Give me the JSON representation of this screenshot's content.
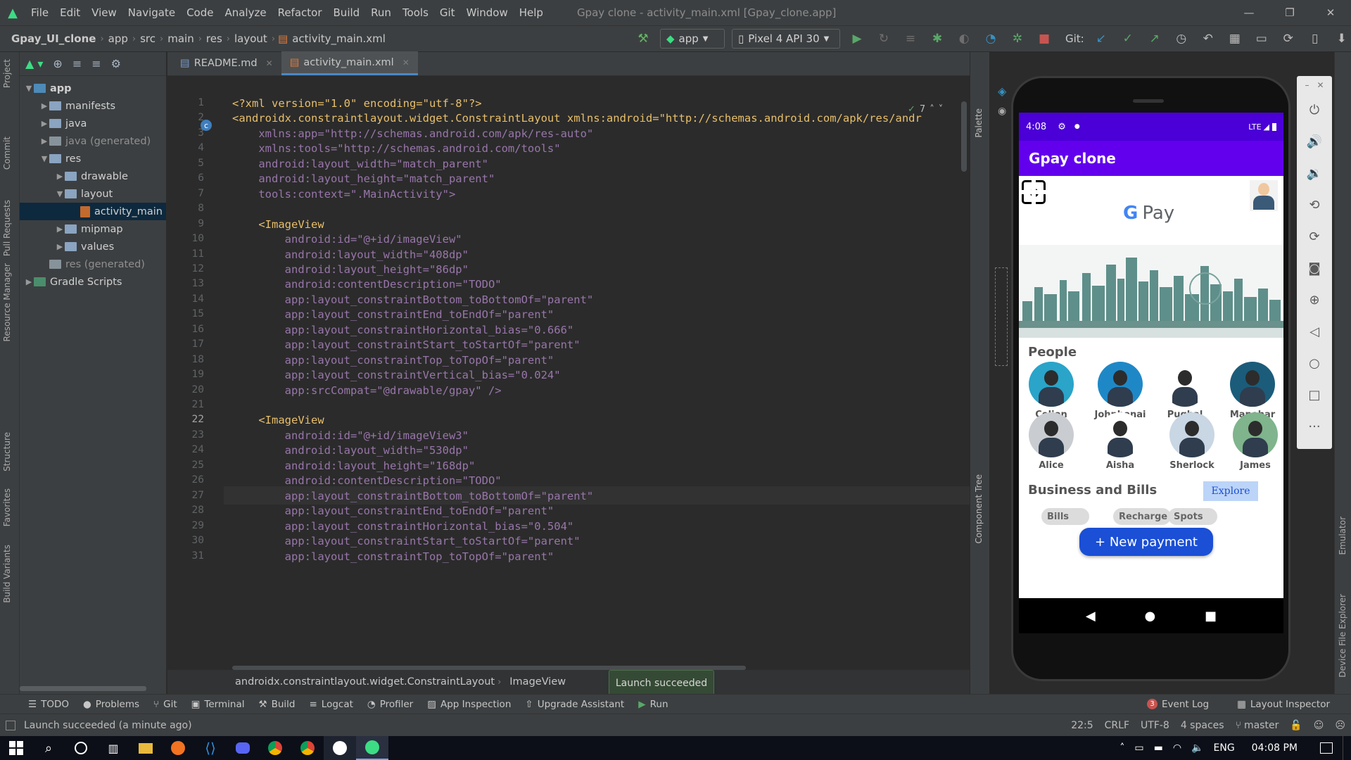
{
  "menu": {
    "items": [
      "File",
      "Edit",
      "View",
      "Navigate",
      "Code",
      "Analyze",
      "Refactor",
      "Build",
      "Run",
      "Tools",
      "Git",
      "Window",
      "Help"
    ],
    "title": "Gpay clone - activity_main.xml [Gpay_clone.app]"
  },
  "nav": {
    "crumbs": [
      "Gpay_UI_clone",
      "app",
      "src",
      "main",
      "res",
      "layout",
      "activity_main.xml"
    ],
    "run_config": "app",
    "device": "Pixel 4 API 30",
    "git_label": "Git:"
  },
  "project": {
    "items": [
      {
        "label": "app",
        "depth": 0,
        "open": true,
        "kind": "mod"
      },
      {
        "label": "manifests",
        "depth": 1,
        "open": false,
        "kind": "folder"
      },
      {
        "label": "java",
        "depth": 1,
        "open": false,
        "kind": "folder"
      },
      {
        "label": "java (generated)",
        "depth": 1,
        "open": false,
        "kind": "gray"
      },
      {
        "label": "res",
        "depth": 1,
        "open": true,
        "kind": "folder"
      },
      {
        "label": "drawable",
        "depth": 2,
        "open": false,
        "kind": "folder"
      },
      {
        "label": "layout",
        "depth": 2,
        "open": true,
        "kind": "folder"
      },
      {
        "label": "activity_main",
        "depth": 3,
        "open": null,
        "kind": "xml",
        "selected": true
      },
      {
        "label": "mipmap",
        "depth": 2,
        "open": false,
        "kind": "folder"
      },
      {
        "label": "values",
        "depth": 2,
        "open": false,
        "kind": "folder"
      },
      {
        "label": "res (generated)",
        "depth": 1,
        "open": null,
        "kind": "gray"
      },
      {
        "label": "Gradle Scripts",
        "depth": 0,
        "open": false,
        "kind": "gradle"
      }
    ]
  },
  "left_stripe": [
    "Project",
    "Commit",
    "Pull Requests",
    "Resource Manager",
    "Structure",
    "Favorites",
    "Build Variants"
  ],
  "editor": {
    "tabs": [
      {
        "label": "README.md",
        "active": false
      },
      {
        "label": "activity_main.xml",
        "active": true
      }
    ],
    "inspections": "7",
    "line_numbers": [
      "1",
      "2",
      "3",
      "4",
      "5",
      "6",
      "7",
      "8",
      "9",
      "10",
      "11",
      "12",
      "13",
      "14",
      "15",
      "16",
      "17",
      "18",
      "19",
      "20",
      "21",
      "22",
      "23",
      "24",
      "25",
      "26",
      "27",
      "28",
      "29",
      "30",
      "31"
    ],
    "lines": [
      "<?xml version=\"1.0\" encoding=\"utf-8\"?>",
      "<androidx.constraintlayout.widget.ConstraintLayout xmlns:android=\"http://schemas.android.com/apk/res/andr",
      "    xmlns:app=\"http://schemas.android.com/apk/res-auto\"",
      "    xmlns:tools=\"http://schemas.android.com/tools\"",
      "    android:layout_width=\"match_parent\"",
      "    android:layout_height=\"match_parent\"",
      "    tools:context=\".MainActivity\">",
      "",
      "    <ImageView",
      "        android:id=\"@+id/imageView\"",
      "        android:layout_width=\"408dp\"",
      "        android:layout_height=\"86dp\"",
      "        android:contentDescription=\"TODO\"",
      "        app:layout_constraintBottom_toBottomOf=\"parent\"",
      "        app:layout_constraintEnd_toEndOf=\"parent\"",
      "        app:layout_constraintHorizontal_bias=\"0.666\"",
      "        app:layout_constraintStart_toStartOf=\"parent\"",
      "        app:layout_constraintTop_toTopOf=\"parent\"",
      "        app:layout_constraintVertical_bias=\"0.024\"",
      "        app:srcCompat=\"@drawable/gpay\" />",
      "",
      "    <ImageView",
      "        android:id=\"@+id/imageView3\"",
      "        android:layout_width=\"530dp\"",
      "        android:layout_height=\"168dp\"",
      "        android:contentDescription=\"TODO\"",
      "        app:layout_constraintBottom_toBottomOf=\"parent\"",
      "        app:layout_constraintEnd_toEndOf=\"parent\"",
      "        app:layout_constraintHorizontal_bias=\"0.504\"",
      "        app:layout_constraintStart_toStartOf=\"parent\"",
      "        app:layout_constraintTop_toTopOf=\"parent\""
    ],
    "current_line": 22,
    "breadcrumbs": [
      "androidx.constraintlayout.widget.ConstraintLayout",
      "ImageView"
    ]
  },
  "right_sidebar": [
    "Palette",
    "Component Tree"
  ],
  "far_right": [
    "Emulator",
    "Device File Explorer"
  ],
  "toast": "Launch succeeded",
  "phone": {
    "time": "4:08",
    "network": "LTE",
    "app_title": "Gpay clone",
    "gpay_logo_g": "G",
    "gpay_logo_text": "Pay",
    "people_title": "People",
    "people": [
      {
        "name": "Celion",
        "color": "#2aa4c9"
      },
      {
        "name": "Johnhonai",
        "color": "#1e88c7"
      },
      {
        "name": "Pughal",
        "color": "#ffffff"
      },
      {
        "name": "Manohar",
        "color": "#1b5c7a"
      },
      {
        "name": "Alice",
        "color": "#c9ccd0"
      },
      {
        "name": "Aisha",
        "color": "#ffffff"
      },
      {
        "name": "Sherlock",
        "color": "#c9d6e3"
      },
      {
        "name": "James",
        "color": "#7fb48c"
      }
    ],
    "business_title": "Business and Bills",
    "explore": "Explore",
    "chips": [
      "Bills",
      "Recharge",
      "Spots"
    ],
    "new_payment": "+ New payment"
  },
  "toolwindows": [
    "TODO",
    "Problems",
    "Git",
    "Terminal",
    "Build",
    "Logcat",
    "Profiler",
    "App Inspection",
    "Upgrade Assistant",
    "Run"
  ],
  "toolwindows_right": {
    "event_log": "Event Log",
    "event_count": "3",
    "layout_inspector": "Layout Inspector"
  },
  "status": {
    "message": "Launch succeeded (a minute ago)",
    "position": "22:5",
    "line_sep": "CRLF",
    "encoding": "UTF-8",
    "indent": "4 spaces",
    "branch": "master"
  },
  "taskbar": {
    "lang": "ENG",
    "time": "04:08 PM"
  },
  "colors": {
    "accent": "#6200ee",
    "status_bar": "#4a00d6",
    "new_payment": "#1a4fd6",
    "explore_bg": "#bcd4f7"
  }
}
